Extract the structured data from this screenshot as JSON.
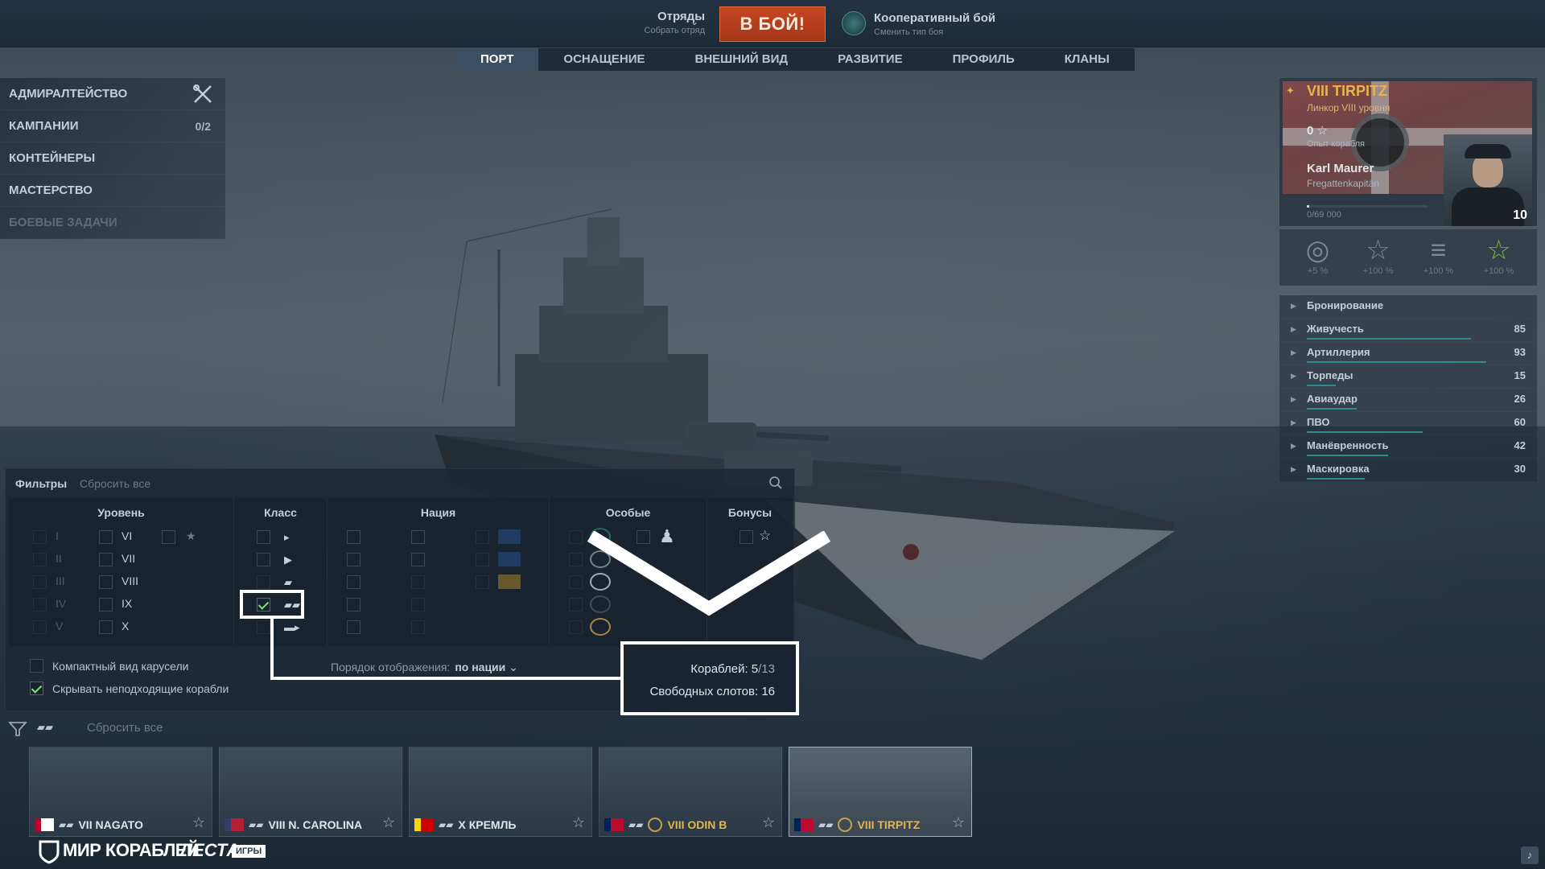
{
  "topbar": {
    "squad_title": "Отряды",
    "squad_sub": "Собрать отряд",
    "battle_button": "В БОЙ!",
    "mode_title": "Кооперативный бой",
    "mode_sub": "Сменить тип боя"
  },
  "tabs": [
    {
      "label": "ПОРТ",
      "active": true
    },
    {
      "label": "ОСНАЩЕНИЕ",
      "active": false
    },
    {
      "label": "ВНЕШНИЙ ВИД",
      "active": false
    },
    {
      "label": "РАЗВИТИЕ",
      "active": false
    },
    {
      "label": "ПРОФИЛЬ",
      "active": false
    },
    {
      "label": "КЛАНЫ",
      "active": false
    }
  ],
  "left_menu": {
    "admiralty": "АДМИРАЛТЕЙСТВО",
    "campaigns": "КАМПАНИИ",
    "campaigns_count": "0/2",
    "containers": "КОНТЕЙНЕРЫ",
    "mastery": "МАСТЕРСТВО",
    "combat_missions": "БОЕВЫЕ ЗАДАЧИ"
  },
  "ship_panel": {
    "name": "VIII TIRPITZ",
    "type": "Линкор VIII уровня",
    "stars": "0 ☆",
    "exp_label": "Опыт корабля",
    "captain_name": "Karl Maurer",
    "captain_rank": "Fregattenkapitän",
    "captain_xp": "0/69 000",
    "captain_level": "10",
    "captain_progress": 0.02,
    "flags": [
      {
        "icon": "credits-flag-icon",
        "label": "+5 %"
      },
      {
        "icon": "star-flag-icon",
        "label": "+100 %"
      },
      {
        "icon": "commander-flag-icon",
        "label": "+100 %"
      },
      {
        "icon": "green-star-flag-icon",
        "label": "+100 %"
      }
    ],
    "params": [
      {
        "label": "Бронирование",
        "value": "",
        "fill": 0
      },
      {
        "label": "Живучесть",
        "value": "85",
        "fill": 0.85
      },
      {
        "label": "Артиллерия",
        "value": "93",
        "fill": 0.93
      },
      {
        "label": "Торпеды",
        "value": "15",
        "fill": 0.15
      },
      {
        "label": "Авиаудар",
        "value": "26",
        "fill": 0.26
      },
      {
        "label": "ПВО",
        "value": "60",
        "fill": 0.6
      },
      {
        "label": "Манёвренность",
        "value": "42",
        "fill": 0.42
      },
      {
        "label": "Маскировка",
        "value": "30",
        "fill": 0.3
      }
    ]
  },
  "filters": {
    "title": "Фильтры",
    "reset_all": "Сбросить все",
    "col_level": "Уровень",
    "col_class": "Класс",
    "col_nation": "Нация",
    "col_special": "Особые",
    "col_bonus": "Бонусы",
    "levels_left": [
      "I",
      "II",
      "III",
      "IV",
      "V"
    ],
    "levels_right": [
      "VI",
      "VII",
      "VIII",
      "IX",
      "X"
    ],
    "compact_view": "Компактный вид карусели",
    "hide_unsuitable": "Скрывать неподходящие корабли",
    "order_label": "Порядок отображения:",
    "order_value": "по нации",
    "ships_label": "Кораблей: 5",
    "ships_total": "/13",
    "slots_label": "Свободных слотов: 16"
  },
  "carousel": {
    "reset_all": "Сбросить все",
    "cards": [
      {
        "name": "VII NAGATO",
        "flag": "japan",
        "gold": false,
        "selected": false
      },
      {
        "name": "VIII N. CAROLINA",
        "flag": "usa",
        "gold": false,
        "selected": false
      },
      {
        "name": "X КРЕМЛЬ",
        "flag": "ussr",
        "gold": false,
        "selected": false
      },
      {
        "name": "VIII ODIN B",
        "flag": "norway",
        "gold": true,
        "selected": false
      },
      {
        "name": "VIII TIRPITZ",
        "flag": "norway",
        "gold": true,
        "selected": true
      }
    ]
  },
  "footer": {
    "logo_main": "МИР КОРАБЛЕЙ",
    "logo_publisher": "ЛЕСТА",
    "logo_badge": "ИГРЫ"
  },
  "colors": {
    "battle_button": "#c7461f",
    "gold_text": "#e8b44a",
    "param_bar": "#2f8c8f",
    "check_green": "#7ee07e"
  }
}
